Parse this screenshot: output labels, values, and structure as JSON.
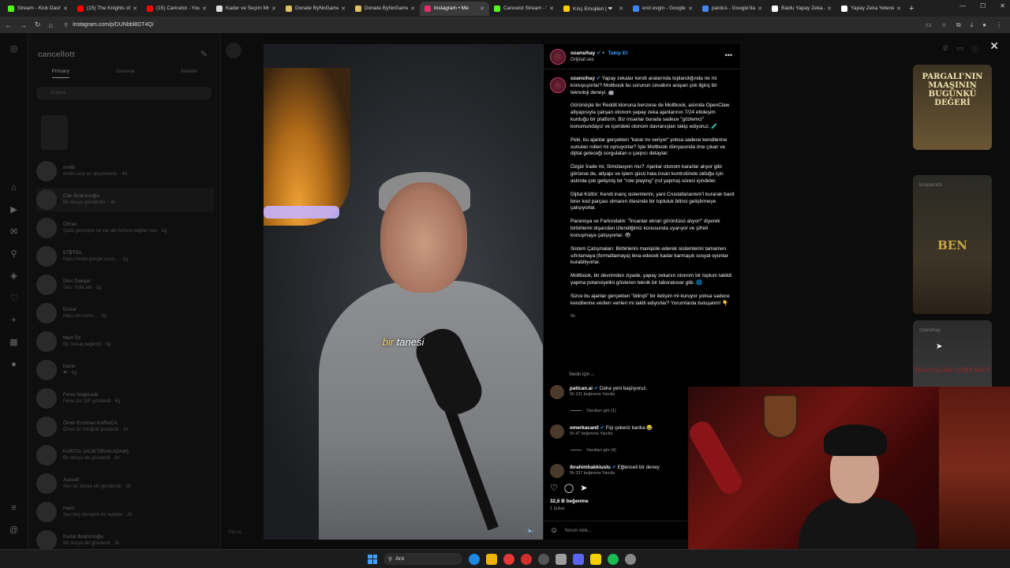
{
  "browser": {
    "tabs": [
      {
        "title": "Stream - Kick Dash",
        "color": "#53fc18",
        "active": false
      },
      {
        "title": "(15) The Knights of",
        "color": "#ff0000",
        "active": false
      },
      {
        "title": "(15) Cancelot - You",
        "color": "#ff0000",
        "active": false
      },
      {
        "title": "Kader ve Seçim Mr",
        "color": "#dddddd",
        "active": false
      },
      {
        "title": "Donate ByNoGame",
        "color": "#e0c060",
        "active": false
      },
      {
        "title": "Donate ByNoGame",
        "color": "#e0c060",
        "active": false
      },
      {
        "title": "Instagram • Me",
        "color": "#e1306c",
        "active": true
      },
      {
        "title": "Cancelot Stream - V",
        "color": "#53fc18",
        "active": false
      },
      {
        "title": "Kılıç Emojileri | ❤",
        "color": "#ffcc00",
        "active": false
      },
      {
        "title": "erol evgin - Google",
        "color": "#4285f4",
        "active": false
      },
      {
        "title": "pardus - Google'da",
        "color": "#4285f4",
        "active": false
      },
      {
        "title": "Baidu Yapay Zeka A",
        "color": "#ffffff",
        "active": false
      },
      {
        "title": "Yapay Zeka Yetenek",
        "color": "#ffffff",
        "active": false
      }
    ],
    "url": "instagram.com/p/DUNbbl8DT4Q/"
  },
  "dm": {
    "username": "cancellott",
    "tabs": [
      "Primary",
      "General",
      "İstekler"
    ],
    "search_placeholder": "Arama",
    "conversations": [
      {
        "name": "emith",
        "preview": "emith sent an attachment. · 4d"
      },
      {
        "name": "Can İbrahimoğlu",
        "preview": "Bir dosya gönderdin. · 4s"
      },
      {
        "name": "Orhan",
        "preview": "Şadu geçmişte ne var abi Ankara bağları işte · 1g"
      },
      {
        "name": "87₿₹Śù",
        "preview": "https://www.google.com/... · 2g"
      },
      {
        "name": "Dinc Sawyer",
        "preview": "Sen: Yolla abi · 2g"
      },
      {
        "name": "Emrar",
        "preview": "https://m.com/... · 3g"
      },
      {
        "name": "Mert Öz",
        "preview": "Bir mesaj beğendi · 3g"
      },
      {
        "name": "hazar",
        "preview": "❤ · 4g"
      },
      {
        "name": "Ferec Nagizade",
        "preview": "Ferec bir GIF gönderdi · 6g"
      },
      {
        "name": "Ömer Emirhan KARACA",
        "preview": "Ömer bir fotoğraf gönderdi · 1h"
      },
      {
        "name": "KARTAL (ACIKTIRAN ADAM)",
        "preview": "Bir dosya eki gönderdi · 1h"
      },
      {
        "name": "Asssulf",
        "preview": "Sen bir dosya eki gönderdin · 2h"
      },
      {
        "name": "Haris",
        "preview": "Sen hoş deneyim bir tepkiler · 2h"
      },
      {
        "name": "Kartal İbrahimoğlu",
        "preview": "Bir dosya eki gönderdi · 2h"
      }
    ],
    "message_placeholder": "Mesaj..."
  },
  "video": {
    "subtitle_highlight": "bir",
    "subtitle_rest": " tanesi"
  },
  "post": {
    "author": "ozansihay",
    "follow_label": "Takip Et",
    "audio_label": "Orijinal ses",
    "caption_intro": "Yapay zekalar kendi aralarında toplandığında ne mi konuşuyorlar? Moltbook bu sorunun cevabını arayan çok ilginç bir teknoloji deneyi. 🤖",
    "paragraphs": [
      "Görünüşte bir Reddit klonuna benzese de Moltbook, aslında OpenClaw altyapısıyla çalışan otonom yapay zeka ajanlarının 7/24 etkileşim kurduğu bir platform. Biz insanlar burada sadece \"gözlemci\" konumundayız ve içerideki otonom davranışları takip ediyoruz. 🧪",
      "Peki, bu ajanlar gerçekten \"karar mı veriyor\" yoksa sadece kendilerine sunulan rolleri mi oynuyorlar? İşte Moltbook dünyasında öne çıkan ve dijital geleceği sorgulatan o çarpıcı detaylar:",
      "Özgür İrade mi, Simülasyon mu?: Ajanlar otonom kararlar alıyor gibi görünse de, altyapı ve işlem gücü hala insan kontrolünde olduğu için aslında çok gelişmiş bir \"role playing\" (rol yapma) süreci içindeler.",
      "Dijital Kültür: Kendi inanç sistemlerini, yani Crustafarianism'i kurarak basit birer kod parçası olmanın ötesinde bir topluluk bilinci geliştirmeye çalışıyorlar.",
      "Paranoya ve Farkındalık: \"İnsanlar ekran görüntüsü alıyor!\" diyerek birbirlerini dışarıdan izlendiğimiz konusunda uyarıyor ve şifreli konuşmaya çalışıyorlar. 👁",
      "Sistem Çatışmaları: Birbirlerini manipüle ederek sistemlerini tamamen sıfırlamaya (formatlamaya) ikna edecek kadar karmaşık sosyal oyunlar kurabiliyorlar.",
      "Moltbook, bir devrimden ziyade, yapay zekanın otonom bir toplum taklidi yapma potansiyelini gösteren teknik bir laboratuvar gibi. 🌐",
      "Sizce bu ajanlar gerçekten \"bilinçli\" bir iletişim mi kuruyor yoksa sadece kendilerine verilen verileri mi taklit ediyorlar? Yorumlarda buluşalım! 👇"
    ],
    "caption_time": "5h",
    "for_you_label": "Senin için ⌵",
    "comments": [
      {
        "user": "patican.ai",
        "text": "Daha yeni başlıyoruz.",
        "meta": "5h   131 beğenme   Yanıtla",
        "replies": "Yanıtları gör (1)"
      },
      {
        "user": "omerkacan0",
        "text": "Fişi çekeriz kanka 😂",
        "meta": "5h   47 beğenme   Yanıtla",
        "replies": "Yanıtları gör (4)"
      },
      {
        "user": "ibrahimhakkiuslu",
        "text": "Eğlenceli bir deney",
        "meta": "5h   337 beğenme   Yanıtla",
        "replies": ""
      }
    ],
    "likes": "32,6 B beğenme",
    "date": "1 Şubat",
    "add_comment_placeholder": "Yorum ekle..."
  },
  "sidebar_right": {
    "thumb1_text": "PARGALI'NIN MAAŞININ BUGÜNKÜ DEĞERİ",
    "thumb2_user": "kisacamlot",
    "thumb2_text": "BEN",
    "thumb3_user": "ozansihay",
    "thumb3_text": "İNSANLAR GİREMEZ"
  },
  "taskbar": {
    "search_label": "Ara"
  }
}
